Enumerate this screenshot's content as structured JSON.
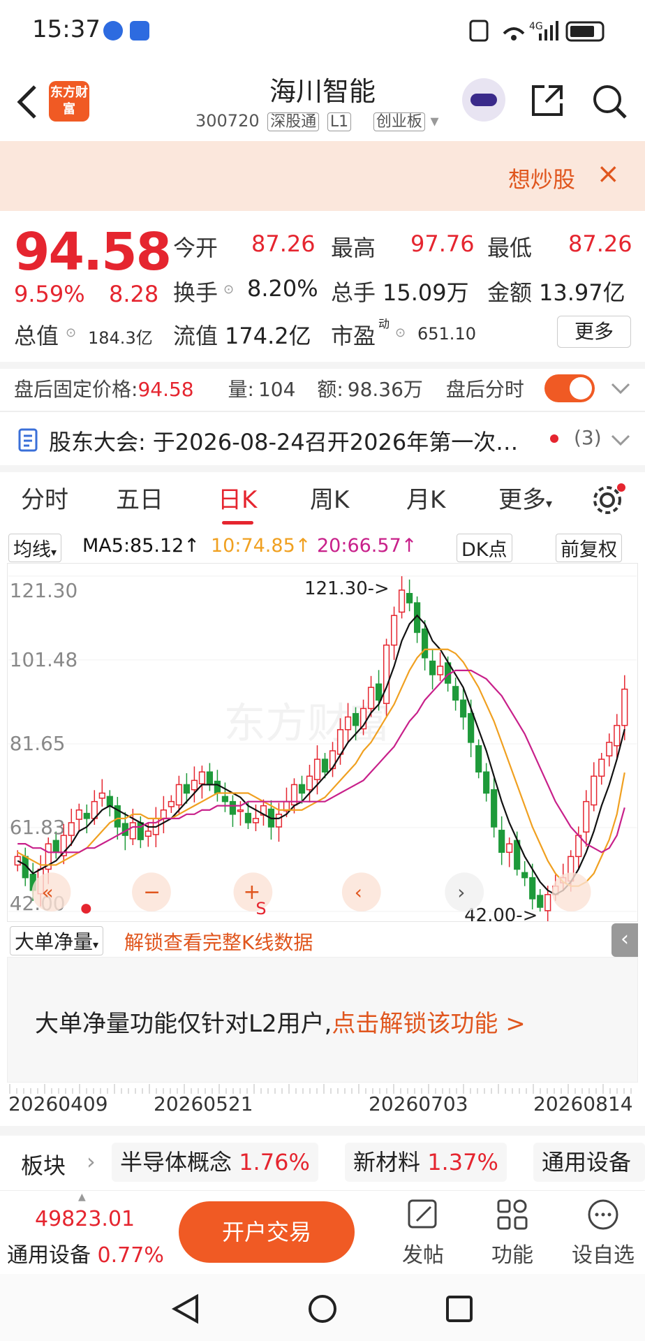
{
  "status": {
    "time": "15:37",
    "network": "4G"
  },
  "header": {
    "back_icon": "chevron-left-icon",
    "logo_text": "东方财富",
    "title": "海川智能",
    "code": "300720",
    "tag1": "深股通",
    "tag2": "L1",
    "tag3": "创业板"
  },
  "banner": {
    "text": "想炒股",
    "close": "×"
  },
  "quote": {
    "price": "94.58",
    "change_pct": "9.59%",
    "change": "8.28",
    "open_label": "今开",
    "open": "87.26",
    "high_label": "最高",
    "high": "97.76",
    "low_label": "最低",
    "low": "87.26",
    "turnover_label": "换手",
    "turnover": "8.20%",
    "volume_label": "总手",
    "volume": "15.09万",
    "amount_label": "金额",
    "amount": "13.97亿",
    "mcap_label": "总值",
    "mcap": "184.3亿",
    "float_label": "流值",
    "float": "174.2亿",
    "pe_label": "市盈",
    "pe_sup": "动",
    "pe": "651.10",
    "more": "更多"
  },
  "afterhours": {
    "label": "盘后固定价格:",
    "price": "94.58",
    "vol_label": "量:",
    "vol": "104",
    "amt_label": "额:",
    "amt": "98.36万",
    "toggle_label": "盘后分时"
  },
  "notice": {
    "label": "股东大会:",
    "text": "于2026-08-24召开2026年第一次…",
    "count": "(3)"
  },
  "tabs": [
    "分时",
    "五日",
    "日K",
    "周K",
    "月K",
    "更多"
  ],
  "ma": {
    "selector": "均线",
    "ma5": "MA5:85.12↑",
    "ma10": "10:74.85↑",
    "ma20": "20:66.57↑",
    "dk": "DK点",
    "adjust": "前复权"
  },
  "chart_data": {
    "type": "candlestick",
    "y_ticks": [
      "121.30",
      "101.48",
      "81.65",
      "61.83",
      "42.00"
    ],
    "ylim": [
      42.0,
      121.3
    ],
    "max_label": "121.30->",
    "min_label": "42.00->",
    "dates": [
      "20260409",
      "20260521",
      "20260703",
      "20260814"
    ],
    "watermark": "东方财富",
    "closes": [
      55,
      50,
      47,
      52,
      58,
      56,
      60,
      63,
      66,
      64,
      68,
      70,
      67,
      62,
      60,
      63,
      59,
      61,
      64,
      66,
      68,
      72,
      70,
      73,
      75,
      72,
      70,
      68,
      65,
      66,
      63,
      64,
      67,
      62,
      65,
      68,
      72,
      70,
      74,
      78,
      75,
      80,
      85,
      88,
      86,
      90,
      95,
      92,
      105,
      112,
      118,
      115,
      108,
      102,
      98,
      100,
      96,
      92,
      88,
      82,
      75,
      70,
      62,
      56,
      58,
      52,
      50,
      45,
      43,
      46,
      48,
      50,
      55,
      60,
      68,
      74,
      78,
      82,
      86,
      94.58
    ],
    "ma5": [
      54,
      53,
      51,
      52,
      53,
      54,
      56,
      58,
      61,
      62,
      64,
      66,
      67,
      66,
      65,
      64,
      63,
      62,
      62,
      63,
      64,
      66,
      68,
      70,
      72,
      72,
      72,
      71,
      70,
      69,
      67,
      66,
      65,
      64,
      64,
      65,
      67,
      68,
      70,
      72,
      74,
      76,
      79,
      82,
      84,
      86,
      89,
      91,
      95,
      100,
      106,
      110,
      112,
      110,
      106,
      104,
      101,
      98,
      95,
      90,
      85,
      80,
      74,
      68,
      63,
      59,
      55,
      52,
      49,
      47,
      46,
      47,
      49,
      52,
      56,
      61,
      67,
      72,
      78,
      85.12
    ],
    "ma10": [
      56,
      55,
      54,
      53,
      53,
      53,
      54,
      55,
      56,
      57,
      59,
      61,
      63,
      64,
      64,
      65,
      65,
      64,
      64,
      64,
      64,
      65,
      66,
      67,
      68,
      69,
      70,
      70,
      70,
      70,
      70,
      69,
      68,
      67,
      66,
      66,
      66,
      66,
      67,
      68,
      69,
      71,
      73,
      75,
      77,
      80,
      82,
      85,
      88,
      91,
      95,
      99,
      102,
      104,
      104,
      104,
      104,
      103,
      101,
      98,
      95,
      91,
      87,
      82,
      77,
      72,
      67,
      62,
      58,
      54,
      51,
      49,
      48,
      48,
      49,
      51,
      55,
      59,
      65,
      74.85
    ],
    "ma20": [
      58,
      58,
      57,
      57,
      56,
      56,
      56,
      56,
      56,
      57,
      57,
      58,
      59,
      60,
      61,
      62,
      62,
      63,
      63,
      64,
      64,
      64,
      65,
      65,
      66,
      66,
      67,
      67,
      67,
      67,
      68,
      68,
      68,
      68,
      68,
      68,
      68,
      68,
      68,
      68,
      68,
      69,
      70,
      71,
      72,
      73,
      75,
      77,
      79,
      81,
      84,
      87,
      89,
      92,
      94,
      96,
      98,
      99,
      99,
      99,
      98,
      97,
      95,
      93,
      90,
      87,
      84,
      80,
      76,
      72,
      68,
      65,
      62,
      60,
      58,
      57,
      56,
      57,
      60,
      66.57
    ]
  },
  "l2": {
    "selector": "大单净量",
    "unlock": "解锁查看完整K线数据",
    "panel_text": "大单净量功能仅针对L2用户,",
    "panel_link": "点击解锁该功能 >"
  },
  "sector": {
    "label": "板块",
    "chips": [
      {
        "name": "半导体概念",
        "pct": "1.76%"
      },
      {
        "name": "新材料",
        "pct": "1.37%"
      },
      {
        "name": "通用设备",
        "pct": ""
      }
    ]
  },
  "bottom": {
    "index_value": "49823.01",
    "index_name": "通用设备",
    "index_pct": "0.77%",
    "trade": "开户交易",
    "tools": [
      "发帖",
      "功能",
      "设自选"
    ]
  },
  "colors": {
    "up": "#e5252f",
    "down": "#1e9a3a",
    "accent": "#f05a24",
    "ma5": "#111111",
    "ma10": "#f0a020",
    "ma20": "#c8208a"
  }
}
